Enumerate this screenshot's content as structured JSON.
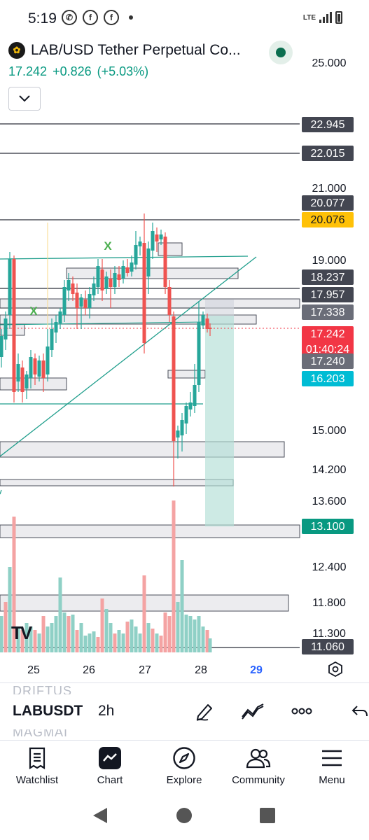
{
  "status_bar": {
    "time": "5:19",
    "network": "LTE"
  },
  "header": {
    "symbol": "LAB/USD Tether Perpetual Co...",
    "price": "17.242",
    "change": "+0.826",
    "change_pct": "(+5.03%)"
  },
  "watermark": "TV",
  "colors": {
    "up": "#26a69a",
    "down": "#ef5350",
    "accent_green": "#089981",
    "label_dark": "#434651",
    "label_red": "#f23645",
    "label_blue": "#00bcd4",
    "label_yellow": "#ffc107",
    "label_teal": "#089981"
  },
  "price_axis": {
    "ticks": [
      "25.000",
      "21.000",
      "19.000",
      "15.000",
      "14.200",
      "13.600",
      "12.400",
      "11.800",
      "11.300"
    ],
    "labels": [
      {
        "text": "22.945",
        "style": "dark"
      },
      {
        "text": "22.015",
        "style": "dark"
      },
      {
        "text": "20.077",
        "style": "dark"
      },
      {
        "text": "20.076",
        "style": "yellow"
      },
      {
        "text": "18.237",
        "style": "dark"
      },
      {
        "text": "17.957",
        "style": "dark"
      },
      {
        "text": "17.338",
        "style": "gray"
      },
      {
        "text": "17.242",
        "sub": "01:40:24",
        "style": "red"
      },
      {
        "text": "17.240",
        "style": "gray"
      },
      {
        "text": "16.203",
        "style": "blue"
      },
      {
        "text": "13.100",
        "style": "teal"
      },
      {
        "text": "11.060",
        "style": "dark"
      }
    ]
  },
  "time_axis": {
    "labels": [
      "25",
      "26",
      "27",
      "28",
      "29"
    ],
    "bold": "29"
  },
  "chart_annotations": {
    "marks": [
      "X",
      "X"
    ]
  },
  "toolbar": {
    "ghost_above": "DRIFTUS",
    "symbol": "LABUSDT",
    "ghost_below": "MAGMAI",
    "interval": "2h"
  },
  "nav": {
    "items": [
      {
        "label": "Watchlist",
        "icon": "watchlist-icon"
      },
      {
        "label": "Chart",
        "icon": "chart-icon"
      },
      {
        "label": "Explore",
        "icon": "compass-icon"
      },
      {
        "label": "Community",
        "icon": "people-icon"
      },
      {
        "label": "Menu",
        "icon": "hamburger-icon"
      }
    ]
  }
}
